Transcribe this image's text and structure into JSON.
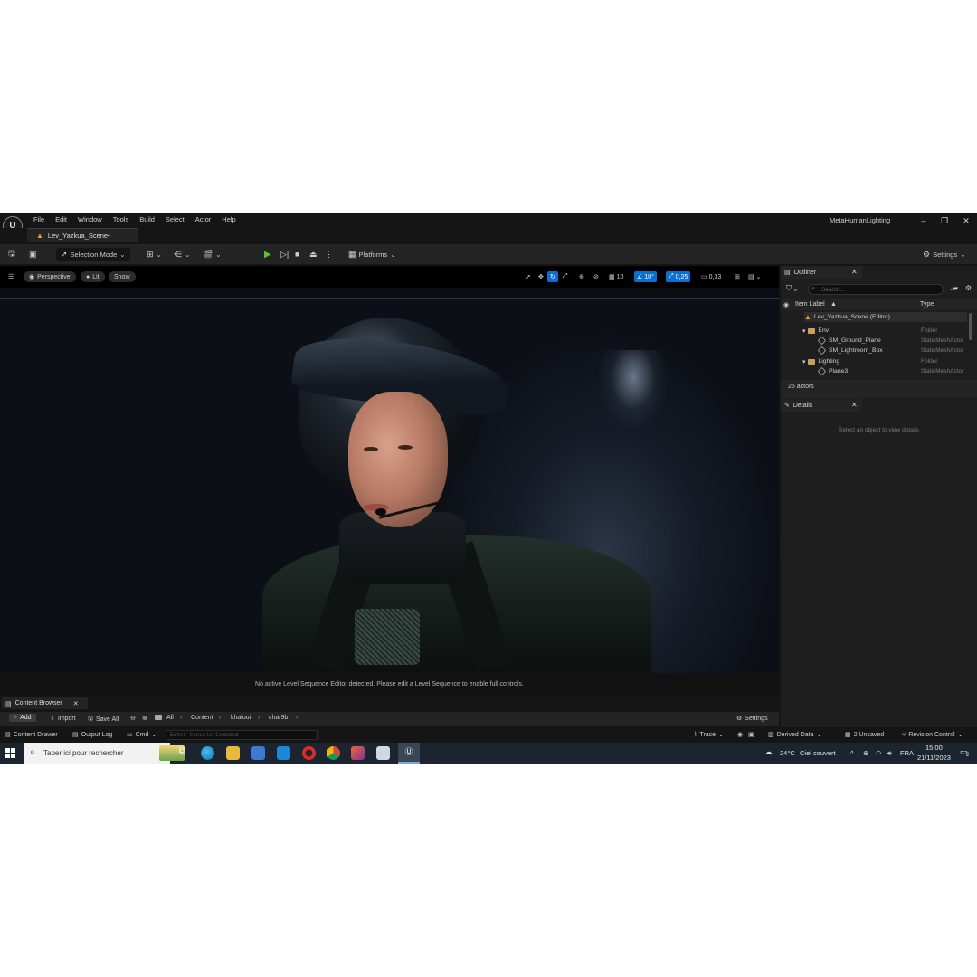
{
  "menus": [
    "File",
    "Edit",
    "Window",
    "Tools",
    "Build",
    "Select",
    "Actor",
    "Help"
  ],
  "project_name": "MetaHumanLighting",
  "level_tab": "Lev_Yazkua_Scene•",
  "toolbar": {
    "selection_mode": "Selection Mode",
    "platforms": "Platforms",
    "settings": "Settings"
  },
  "viewport": {
    "perspective": "Perspective",
    "lit": "Lit",
    "show": "Show",
    "grid_snap": "10",
    "rotation_snap": "10°",
    "scale_snap": "0,25",
    "camera_speed": "0,33",
    "sequence_message": "No active Level Sequence Editor detected. Please edit a Level Sequence to enable full controls."
  },
  "outliner": {
    "title": "Outliner",
    "search_placeholder": "Search...",
    "col_label": "Item Label",
    "col_type": "Type",
    "rows": [
      {
        "label": "Lev_Yazkua_Scene (Editor)",
        "type": ""
      },
      {
        "label": "Env",
        "type": "Folder"
      },
      {
        "label": "SM_Ground_Plane",
        "type": "StaticMeshActor"
      },
      {
        "label": "SM_Lightroom_Box",
        "type": "StaticMeshActor"
      },
      {
        "label": "Lighting",
        "type": "Folder"
      },
      {
        "label": "Plane3",
        "type": "StaticMeshActor"
      }
    ],
    "actor_count": "25 actors"
  },
  "details": {
    "title": "Details",
    "empty_message": "Select an object to view details"
  },
  "content_browser": {
    "tab": "Content Browser",
    "add": "Add",
    "import": "Import",
    "save_all": "Save All",
    "breadcrumbs": [
      "All",
      "Content",
      "khaloui",
      "char9b"
    ],
    "settings": "Settings"
  },
  "statusbar": {
    "content_drawer": "Content Drawer",
    "output_log": "Output Log",
    "cmd": "Cmd",
    "console_placeholder": "Enter Console Command",
    "trace": "Trace",
    "derived_data": "Derived Data",
    "unsaved": "2 Unsaved",
    "revision_control": "Revision Control"
  },
  "taskbar": {
    "search_placeholder": "Taper ici pour rechercher",
    "weather_temp": "24°C",
    "weather_desc": "Ciel couvert",
    "language": "FRA",
    "time": "15:00",
    "date": "21/11/2023",
    "notification_count": "2"
  },
  "colors": {
    "accent": "#0b6fd1",
    "play_green": "#5bc236",
    "folder": "#c9a258",
    "panel_bg": "#1e1e1e"
  }
}
